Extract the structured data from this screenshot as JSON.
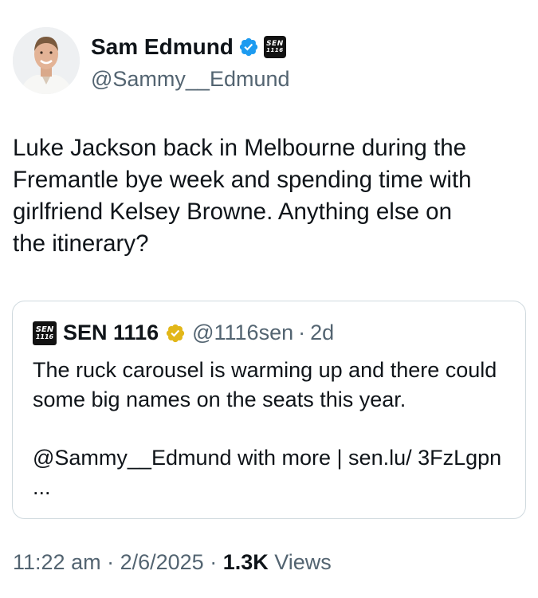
{
  "author": {
    "name": "Sam Edmund",
    "handle": "@Sammy__Edmund",
    "affiliate_badge": {
      "line1": "SEN",
      "line2": "1116"
    }
  },
  "tweet": {
    "text": "Luke Jackson back in Melbourne during the\nFremantle bye week and spending time with\ngirlfriend Kelsey Browne. Anything else on\nthe itinerary?"
  },
  "quote": {
    "logo": {
      "line1": "SEN",
      "line2": "1116"
    },
    "name": "SEN 1116",
    "handle": "@1116sen",
    "separator": "·",
    "time": "2d",
    "text": "The ruck carousel is warming up and there could some big names on the seats this year.",
    "text2": "@Sammy__Edmund with more | sen.lu/ 3FzLgpn ..."
  },
  "meta": {
    "time": "11:22 am",
    "dot1": " · ",
    "date": "2/6/2025",
    "dot2": " · ",
    "views_count": "1.3K",
    "views_label": " Views"
  },
  "colors": {
    "verified_blue": "#1d9bf0",
    "gold_badge": "#e2b719",
    "secondary_text": "#536471",
    "border": "#cfd9de"
  },
  "icons": {
    "verified": "verified-badge-icon",
    "gold": "gold-verified-badge-icon",
    "affiliate": "sen-1116-logo-icon"
  }
}
